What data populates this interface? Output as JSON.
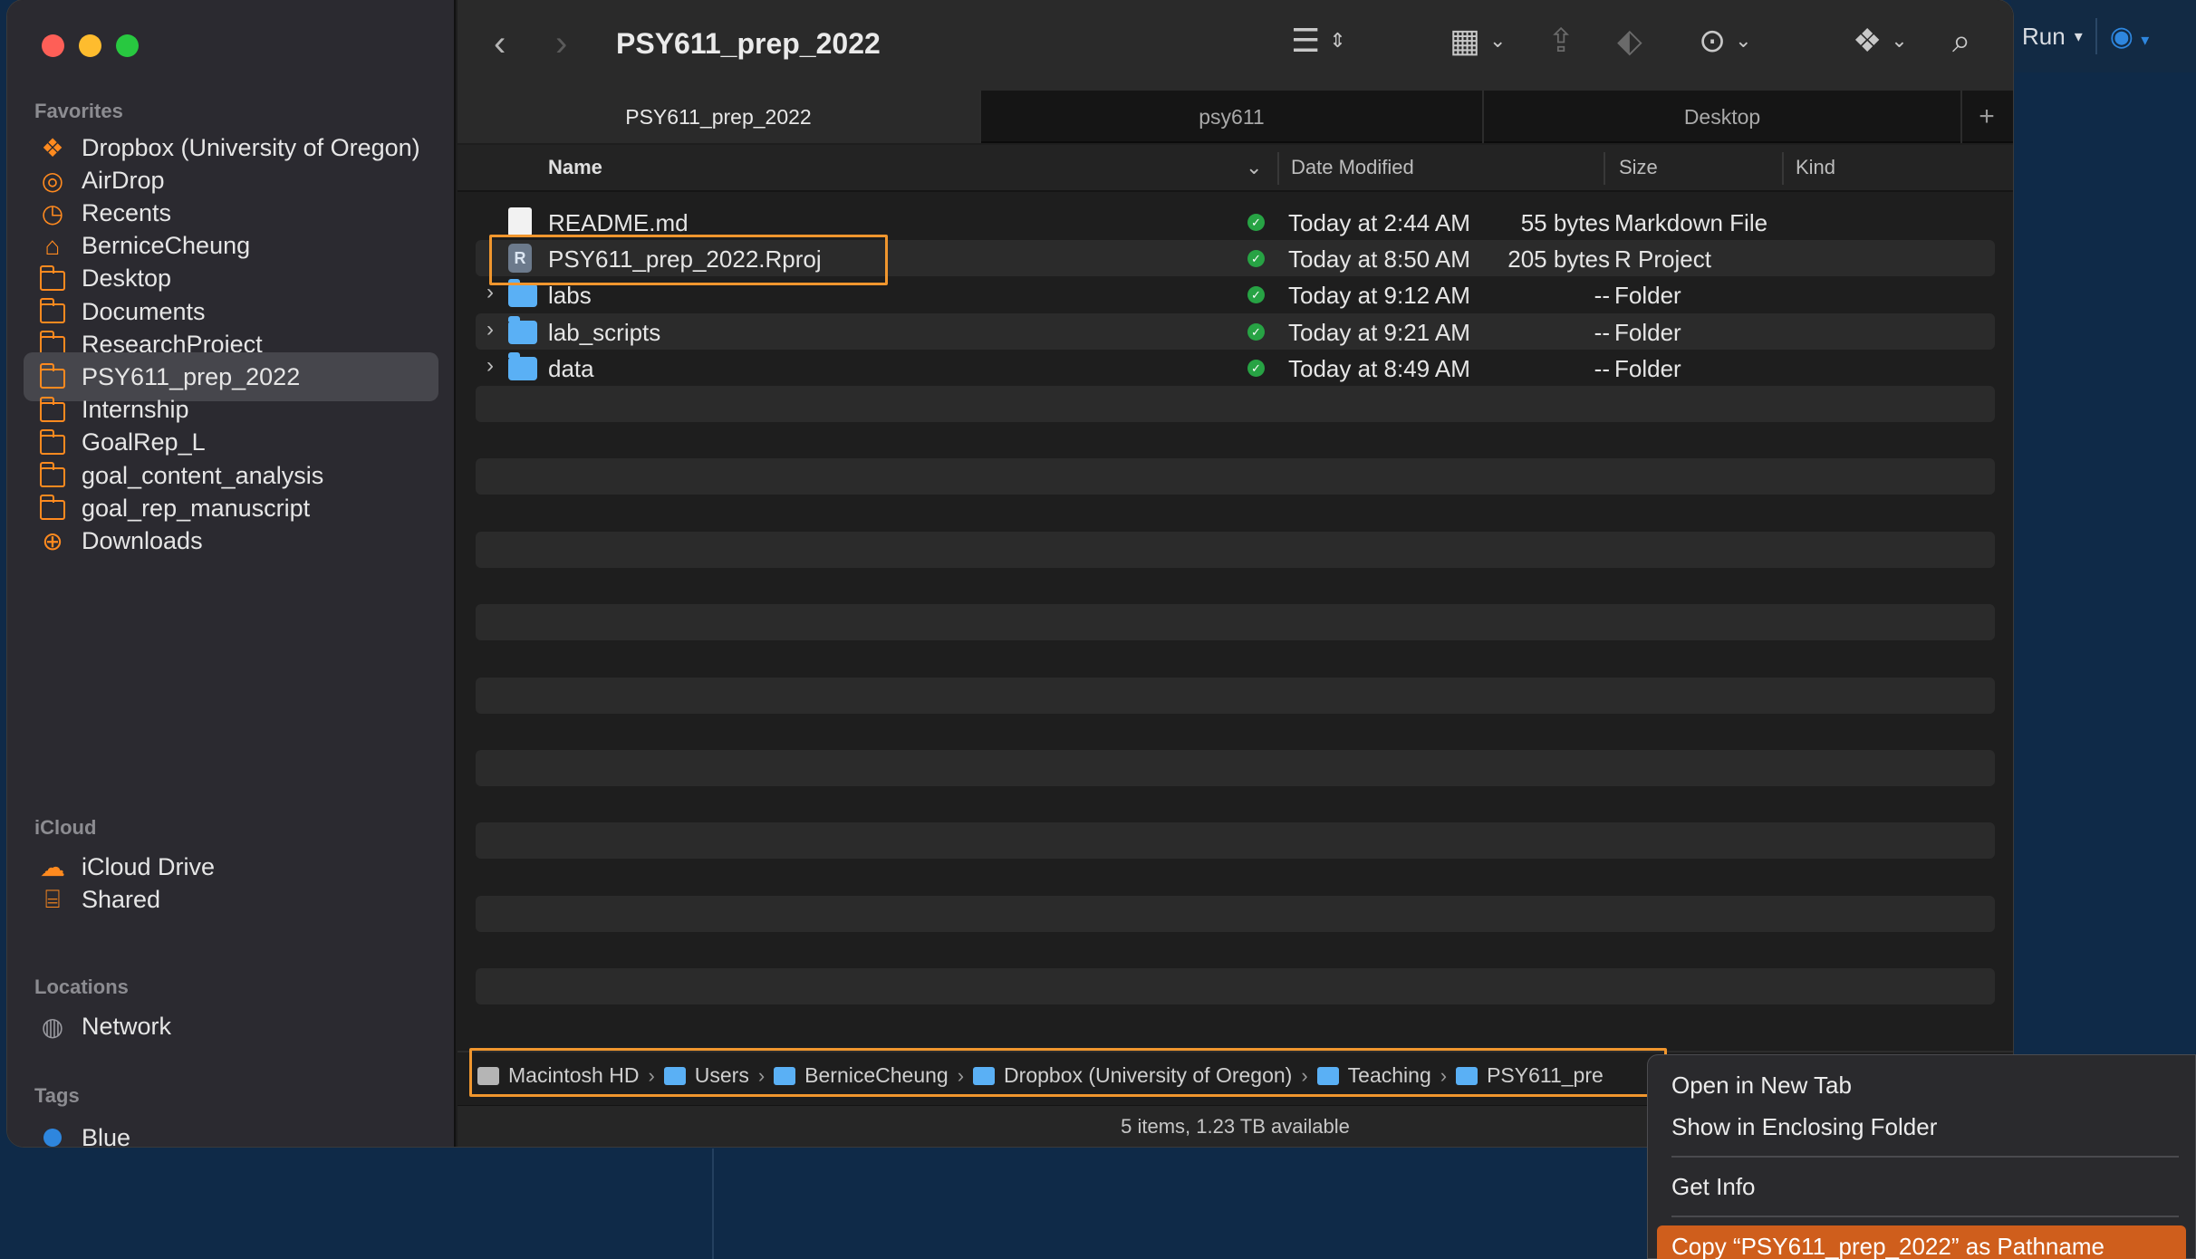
{
  "backdrop": {
    "run_label": "Run"
  },
  "sidebar": {
    "sections": {
      "favorites": "Favorites",
      "icloud": "iCloud",
      "locations": "Locations",
      "tags": "Tags"
    },
    "favorites": [
      {
        "label": "Dropbox (University of Oregon)",
        "icon": "dropbox-icon"
      },
      {
        "label": "AirDrop",
        "icon": "airdrop-icon"
      },
      {
        "label": "Recents",
        "icon": "clock-icon"
      },
      {
        "label": "BerniceCheung",
        "icon": "home-icon"
      },
      {
        "label": "Desktop",
        "icon": "folder-icon"
      },
      {
        "label": "Documents",
        "icon": "folder-icon"
      },
      {
        "label": "ResearchProject",
        "icon": "folder-icon"
      },
      {
        "label": "PSY611_prep_2022",
        "icon": "folder-icon"
      },
      {
        "label": "Internship",
        "icon": "folder-icon"
      },
      {
        "label": "GoalRep_L",
        "icon": "folder-icon"
      },
      {
        "label": "goal_content_analysis",
        "icon": "folder-icon"
      },
      {
        "label": "goal_rep_manuscript",
        "icon": "folder-icon"
      },
      {
        "label": "Downloads",
        "icon": "download-icon"
      }
    ],
    "icloud": [
      {
        "label": "iCloud Drive",
        "icon": "cloud-icon"
      },
      {
        "label": "Shared",
        "icon": "shared-folder-icon"
      }
    ],
    "locations": [
      {
        "label": "Network",
        "icon": "globe-icon"
      }
    ],
    "tags": [
      {
        "label": "Blue",
        "color": "#2e86de"
      }
    ]
  },
  "toolbar": {
    "title": "PSY611_prep_2022"
  },
  "tabs": [
    {
      "label": "PSY611_prep_2022",
      "active": true
    },
    {
      "label": "psy611",
      "active": false
    },
    {
      "label": "Desktop",
      "active": false
    }
  ],
  "columns": {
    "name": "Name",
    "date": "Date Modified",
    "size": "Size",
    "kind": "Kind"
  },
  "files": [
    {
      "name": "README.md",
      "date": "Today at 2:44 AM",
      "size": "55 bytes",
      "kind": "Markdown File",
      "type": "doc"
    },
    {
      "name": "PSY611_prep_2022.Rproj",
      "date": "Today at 8:50 AM",
      "size": "205 bytes",
      "kind": "R Project",
      "type": "rproj"
    },
    {
      "name": "labs",
      "date": "Today at 9:12 AM",
      "size": "--",
      "kind": "Folder",
      "type": "folder"
    },
    {
      "name": "lab_scripts",
      "date": "Today at 9:21 AM",
      "size": "--",
      "kind": "Folder",
      "type": "folder"
    },
    {
      "name": "data",
      "date": "Today at 8:49 AM",
      "size": "--",
      "kind": "Folder",
      "type": "folder"
    }
  ],
  "pathbar": [
    {
      "label": "Macintosh HD",
      "icon": "disk-icon"
    },
    {
      "label": "Users",
      "icon": "folder-icon"
    },
    {
      "label": "BerniceCheung",
      "icon": "folder-icon"
    },
    {
      "label": "Dropbox (University of Oregon)",
      "icon": "folder-icon"
    },
    {
      "label": "Teaching",
      "icon": "folder-icon"
    },
    {
      "label": "PSY611_pre",
      "icon": "folder-icon"
    }
  ],
  "status": "5 items, 1.23 TB available",
  "context_menu": {
    "open_new_tab": "Open in New Tab",
    "show_enclosing": "Show in Enclosing Folder",
    "get_info": "Get Info",
    "copy_pathname": "Copy “PSY611_prep_2022” as Pathname"
  }
}
